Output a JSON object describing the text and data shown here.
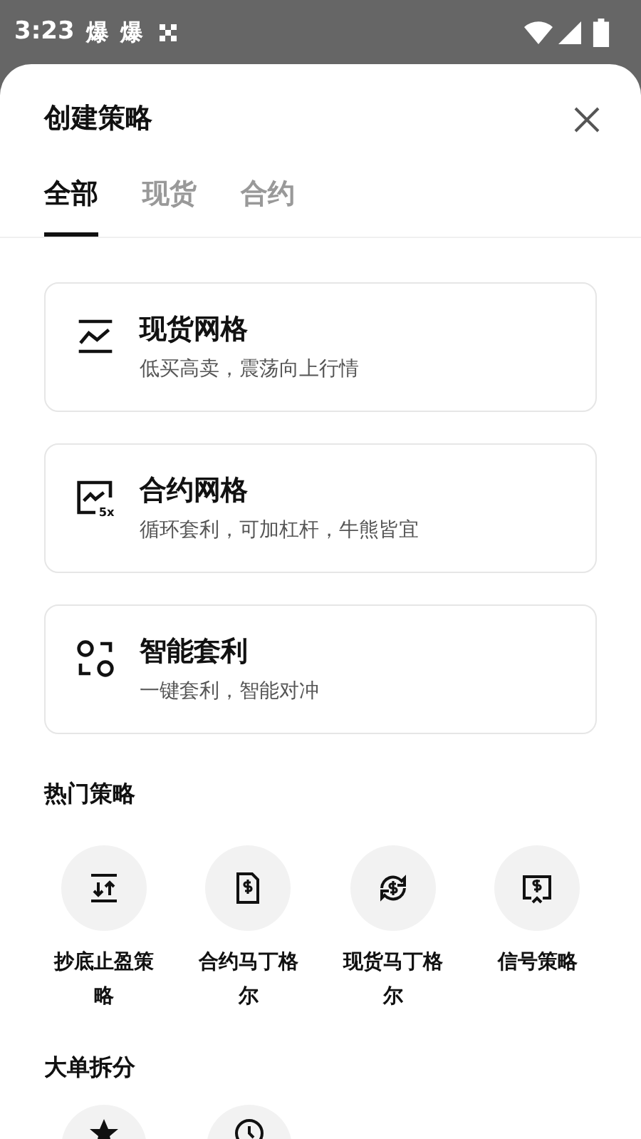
{
  "status_bar": {
    "time": "3:23",
    "notifications": [
      "爆",
      "爆"
    ]
  },
  "sheet": {
    "title": "创建策略"
  },
  "tabs": [
    {
      "label": "全部",
      "selected": true
    },
    {
      "label": "现货",
      "selected": false
    },
    {
      "label": "合约",
      "selected": false
    }
  ],
  "cards": [
    {
      "kind": "spot",
      "title": "现货网格",
      "subtitle": "低买高卖，震荡向上行情"
    },
    {
      "kind": "futures",
      "icon_text": "5x",
      "title": "合约网格",
      "subtitle": "循环套利，可加杠杆，牛熊皆宜"
    },
    {
      "kind": "arbitrage",
      "title": "智能套利",
      "subtitle": "一键套利，智能对冲"
    }
  ],
  "hot": {
    "title": "热门策略",
    "items": [
      {
        "kind": "bottom",
        "label": "抄底止盈策略"
      },
      {
        "kind": "doc",
        "label": "合约马丁格尔"
      },
      {
        "kind": "cycle",
        "label": "现货马丁格尔"
      },
      {
        "kind": "signal",
        "label": "信号策略"
      }
    ]
  },
  "split": {
    "title": "大单拆分",
    "items": [
      {
        "kind": "star"
      },
      {
        "kind": "clock"
      }
    ]
  }
}
